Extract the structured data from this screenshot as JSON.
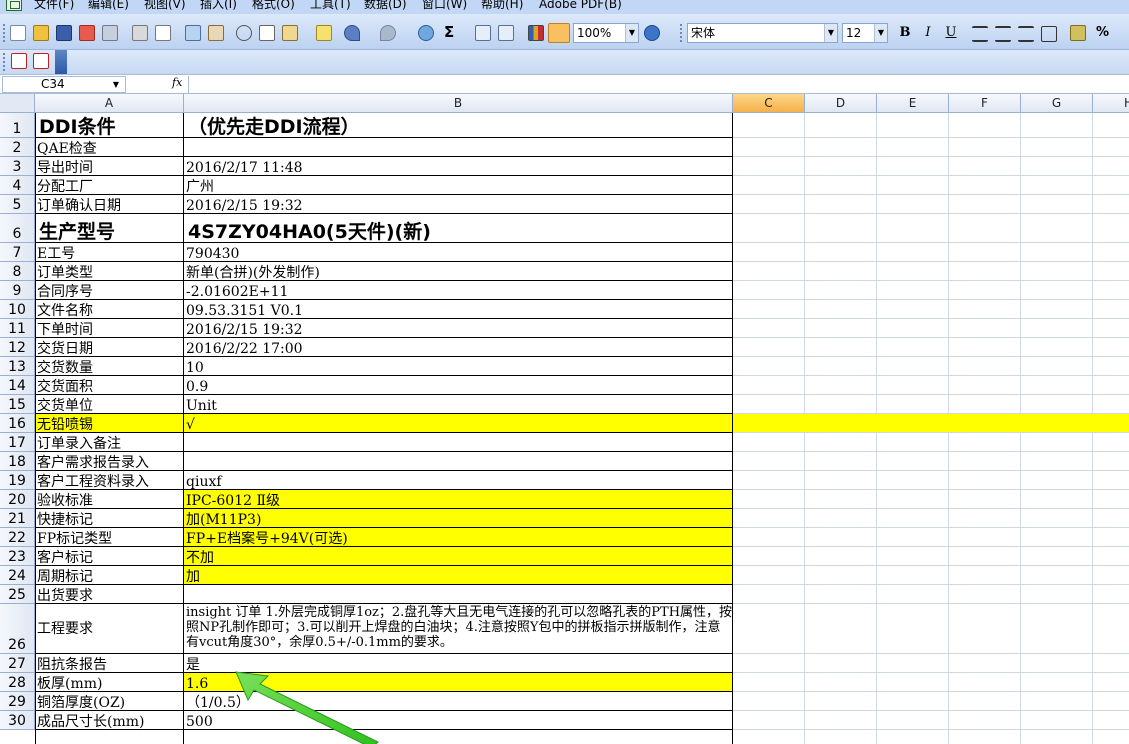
{
  "menu": [
    "文件(F)",
    "编辑(E)",
    "视图(V)",
    "插入(I)",
    "格式(O)",
    "工具(T)",
    "数据(D)",
    "窗口(W)",
    "帮助(H)",
    "Adobe PDF(B)"
  ],
  "toolbar": {
    "zoom": "100%",
    "font_name": "宋体",
    "font_size": "12",
    "bold": "B",
    "italic": "I",
    "underline": "U",
    "percent": "%",
    "sum": "Σ"
  },
  "formula_bar": {
    "name_box": "C34",
    "fx": "fx",
    "formula": ""
  },
  "columns": [
    "A",
    "B",
    "C",
    "D",
    "E",
    "F",
    "G",
    "H"
  ],
  "selected_column": "C",
  "colors": {
    "highlight": "#ffff00",
    "arrow": "#33cc33"
  },
  "rows": [
    {
      "n": "1",
      "a": "DDI条件",
      "b": "（优先走DDI流程）"
    },
    {
      "n": "2",
      "a": "QAE检查",
      "b": ""
    },
    {
      "n": "3",
      "a": "导出时间",
      "b": "2016/2/17 11:48"
    },
    {
      "n": "4",
      "a": "分配工厂",
      "b": "广州"
    },
    {
      "n": "5",
      "a": "订单确认日期",
      "b": "2016/2/15 19:32"
    },
    {
      "n": "6",
      "a": "生产型号",
      "b": "4S7ZY04HA0(5天件)(新)"
    },
    {
      "n": "7",
      "a": "E工号",
      "b": "790430"
    },
    {
      "n": "8",
      "a": "订单类型",
      "b": "新单(合拼)(外发制作)"
    },
    {
      "n": "9",
      "a": "合同序号",
      "b": "-2.01602E+11"
    },
    {
      "n": "10",
      "a": "文件名称",
      "b": "09.53.3151 V0.1"
    },
    {
      "n": "11",
      "a": "下单时间",
      "b": "2016/2/15 19:32"
    },
    {
      "n": "12",
      "a": "交货日期",
      "b": "2016/2/22 17:00"
    },
    {
      "n": "13",
      "a": "交货数量",
      "b": "10"
    },
    {
      "n": "14",
      "a": "交货面积",
      "b": "0.9"
    },
    {
      "n": "15",
      "a": "交货单位",
      "b": "Unit"
    },
    {
      "n": "16",
      "a": "无铅喷锡",
      "b": "√"
    },
    {
      "n": "17",
      "a": "订单录入备注",
      "b": ""
    },
    {
      "n": "18",
      "a": "客户需求报告录入",
      "b": ""
    },
    {
      "n": "19",
      "a": "客户工程资料录入",
      "b": "qiuxf"
    },
    {
      "n": "20",
      "a": "验收标准",
      "b": "IPC-6012 Ⅱ级"
    },
    {
      "n": "21",
      "a": "快捷标记",
      "b": "加(M11P3)"
    },
    {
      "n": "22",
      "a": "FP标记类型",
      "b": "FP+E档案号+94V(可选)"
    },
    {
      "n": "23",
      "a": "客户标记",
      "b": "不加"
    },
    {
      "n": "24",
      "a": "周期标记",
      "b": "加"
    },
    {
      "n": "25",
      "a": "出货要求",
      "b": ""
    },
    {
      "n": "26",
      "a": "工程要求",
      "b": "insight 订单 1.外层完成铜厚1oz；2.盘孔等大且无电气连接的孔可以忽略孔表的PTH属性，按照NP孔制作即可；3.可以削开上焊盘的白油块；4.注意按照Y包中的拼板指示拼版制作，注意有vcut角度30°，余厚0.5+/-0.1mm的要求。"
    },
    {
      "n": "27",
      "a": "阻抗条报告",
      "b": "是"
    },
    {
      "n": "28",
      "a": "板厚(mm)",
      "b": "1.6"
    },
    {
      "n": "29",
      "a": "铜箔厚度(OZ)",
      "b": "（1/0.5）"
    },
    {
      "n": "30",
      "a": "成品尺寸长(mm)",
      "b": "500"
    }
  ]
}
